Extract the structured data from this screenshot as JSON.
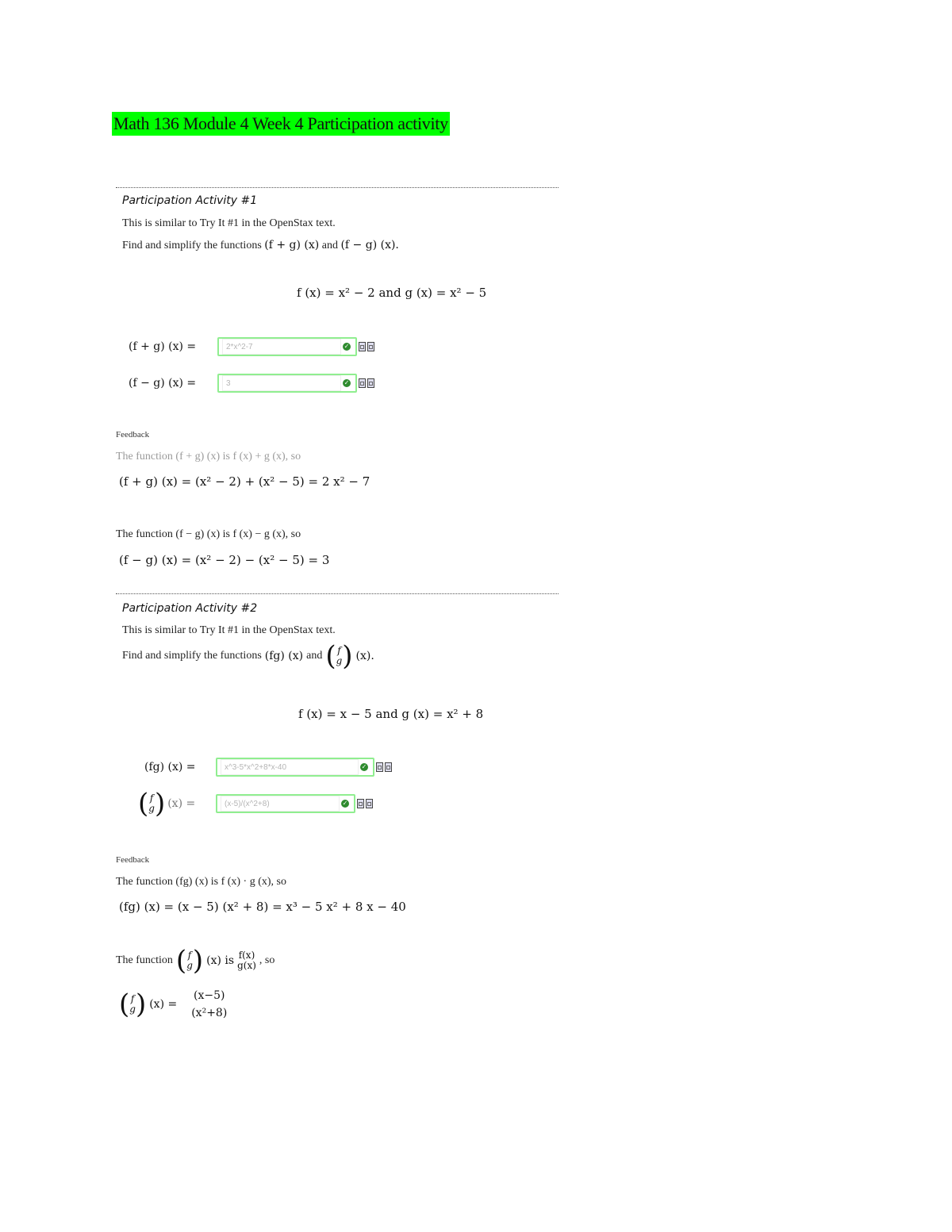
{
  "document": {
    "title": "Math 136 Module 4 Week 4 Participation activity",
    "highlight_color": "#00ff00"
  },
  "activity1": {
    "heading": "Participation Activity #1",
    "intro": "This is similar to Try It #1 in the OpenStax text.",
    "instruction_prefix": "Find and simplify the functions",
    "instruction_expr1": "(f + g) (x)",
    "instruction_and": "and",
    "instruction_expr2": "(f − g) (x).",
    "given": "f (x) = x² − 2 and g (x) = x² − 5",
    "inputs": [
      {
        "label": "(f + g) (x) =",
        "value": "2*x^2-7",
        "status": "correct"
      },
      {
        "label": "(f − g) (x) =",
        "value": "3",
        "status": "correct"
      }
    ],
    "feedback_label": "Feedback",
    "feedback": [
      {
        "statement": "The function (f + g) (x) is f (x) + g (x), so",
        "work": "(f + g) (x) = (x² − 2) + (x² − 5) = 2 x² − 7"
      },
      {
        "statement": "The function (f − g) (x) is f (x) − g (x), so",
        "work": "(f − g) (x) = (x² − 2) − (x² − 5) = 3"
      }
    ]
  },
  "activity2": {
    "heading": "Participation Activity #2",
    "intro": "This is similar to Try It #1 in the OpenStax text.",
    "instruction_prefix": "Find and simplify the functions",
    "instruction_expr1": "(fg) (x)",
    "instruction_and": "and",
    "instruction_expr2": "(x).",
    "given": "f (x) = x − 5 and g (x) = x² + 8",
    "inputs": [
      {
        "label": "(fg) (x) =",
        "value": "x^3-5*x^2+8*x-40",
        "status": "correct"
      },
      {
        "label": "(x) =",
        "value": "(x-5)/(x^2+8)",
        "status": "correct"
      }
    ],
    "feedback_label": "Feedback",
    "feedback": [
      {
        "statement": "The function (fg) (x) is f (x) · g (x), so",
        "work": "(fg) (x) = (x − 5) (x² + 8) = x³ − 5 x² + 8 x − 40"
      },
      {
        "statement_prefix": "The function",
        "statement_mid": "(x) is",
        "statement_suffix": ", so",
        "frac_num": "f(x)",
        "frac_den": "g(x)",
        "work_lhs": "(x) =",
        "work_num": "(x−5)",
        "work_den": "(x²+8)"
      }
    ]
  },
  "icons": {
    "check": "✓"
  }
}
